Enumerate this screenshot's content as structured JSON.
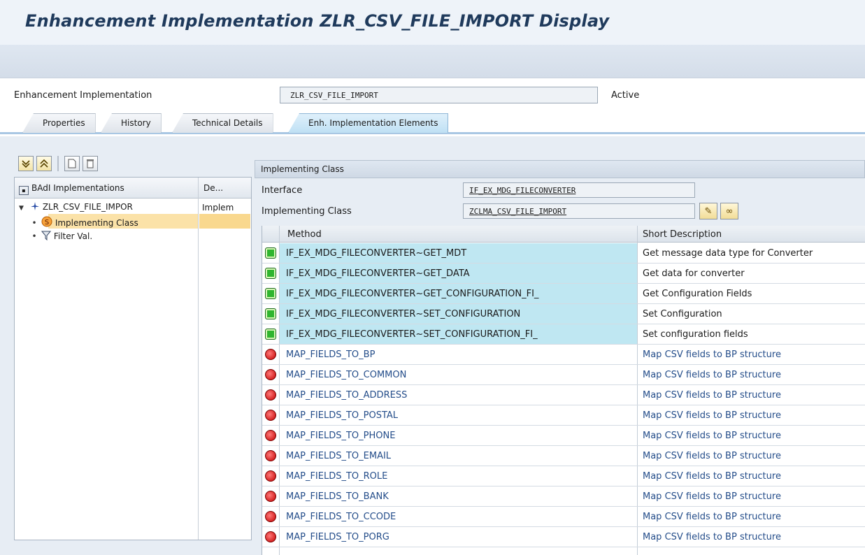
{
  "window": {
    "title": "Enhancement Implementation ZLR_CSV_FILE_IMPORT Display"
  },
  "header": {
    "label": "Enhancement Implementation",
    "value": "ZLR_CSV_FILE_IMPORT",
    "status": "Active"
  },
  "tabs": [
    {
      "label": "Properties"
    },
    {
      "label": "History"
    },
    {
      "label": "Technical Details"
    },
    {
      "label": "Enh. Implementation Elements"
    }
  ],
  "tree": {
    "col1": "BAdI Implementations",
    "col2": "De...",
    "nodes": [
      {
        "label": "ZLR_CSV_FILE_IMPOR",
        "desc": "Implem"
      },
      {
        "label": "Implementing Class",
        "desc": ""
      },
      {
        "label": "Filter Val.",
        "desc": ""
      }
    ]
  },
  "panel": {
    "title": "Implementing Class",
    "interface_label": "Interface",
    "interface_value": "IF_EX_MDG_FILECONVERTER",
    "class_label": "Implementing Class",
    "class_value": "ZCLMA_CSV_FILE_IMPORT"
  },
  "grid": {
    "col_method": "Method",
    "col_desc": "Short Description",
    "rows": [
      {
        "method": "IF_EX_MDG_FILECONVERTER~GET_MDT",
        "desc": "Get message data type for Converter",
        "status": "green"
      },
      {
        "method": "IF_EX_MDG_FILECONVERTER~GET_DATA",
        "desc": "Get data for converter",
        "status": "green"
      },
      {
        "method": "IF_EX_MDG_FILECONVERTER~GET_CONFIGURATION_FI_",
        "desc": "Get Configuration Fields",
        "status": "green"
      },
      {
        "method": "IF_EX_MDG_FILECONVERTER~SET_CONFIGURATION",
        "desc": "Set Configuration",
        "status": "green"
      },
      {
        "method": "IF_EX_MDG_FILECONVERTER~SET_CONFIGURATION_FI_",
        "desc": "Set configuration fields",
        "status": "green"
      },
      {
        "method": "MAP_FIELDS_TO_BP",
        "desc": "Map CSV fields to BP structure",
        "status": "red"
      },
      {
        "method": "MAP_FIELDS_TO_COMMON",
        "desc": "Map CSV fields to BP structure",
        "status": "red"
      },
      {
        "method": "MAP_FIELDS_TO_ADDRESS",
        "desc": "Map CSV fields to BP structure",
        "status": "red"
      },
      {
        "method": "MAP_FIELDS_TO_POSTAL",
        "desc": "Map CSV fields to BP structure",
        "status": "red"
      },
      {
        "method": "MAP_FIELDS_TO_PHONE",
        "desc": "Map CSV fields to BP structure",
        "status": "red"
      },
      {
        "method": "MAP_FIELDS_TO_EMAIL",
        "desc": "Map CSV fields to BP structure",
        "status": "red"
      },
      {
        "method": "MAP_FIELDS_TO_ROLE",
        "desc": "Map CSV fields to BP structure",
        "status": "red"
      },
      {
        "method": "MAP_FIELDS_TO_BANK",
        "desc": "Map CSV fields to BP structure",
        "status": "red"
      },
      {
        "method": "MAP_FIELDS_TO_CCODE",
        "desc": "Map CSV fields to BP structure",
        "status": "red"
      },
      {
        "method": "MAP_FIELDS_TO_PORG",
        "desc": "Map CSV fields to BP structure",
        "status": "red"
      }
    ]
  },
  "colors": {
    "accent": "#1f3a5c",
    "highlight": "#bfe7f2",
    "selection": "#f9d88e"
  }
}
